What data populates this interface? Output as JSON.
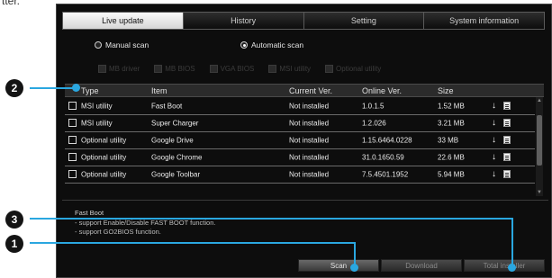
{
  "fragment": "tter.",
  "tabs": [
    "Live update",
    "History",
    "Setting",
    "System information"
  ],
  "scan_mode": {
    "manual_label": "Manual scan",
    "automatic_label": "Automatic scan"
  },
  "filters": [
    "MB driver",
    "MB BIOS",
    "VGA BIOS",
    "MSI utility",
    "Optional utility"
  ],
  "columns": {
    "type": "Type",
    "item": "Item",
    "current": "Current Ver.",
    "online": "Online Ver.",
    "size": "Size"
  },
  "rows": [
    {
      "type": "MSI utility",
      "item": "Fast Boot",
      "current": "Not installed",
      "online": "1.0.1.5",
      "size": "1.52 MB"
    },
    {
      "type": "MSI utility",
      "item": "Super Charger",
      "current": "Not installed",
      "online": "1.2.026",
      "size": "3.21 MB"
    },
    {
      "type": "Optional utility",
      "item": "Google Drive",
      "current": "Not installed",
      "online": "1.15.6464.0228",
      "size": "33 MB"
    },
    {
      "type": "Optional utility",
      "item": "Google Chrome",
      "current": "Not installed",
      "online": "31.0.1650.59",
      "size": "22.6 MB"
    },
    {
      "type": "Optional utility",
      "item": "Google Toolbar",
      "current": "Not installed",
      "online": "7.5.4501.1952",
      "size": "5.94 MB"
    }
  ],
  "description": {
    "title": "Fast Boot",
    "line1": "- support Enable/Disable FAST BOOT function.",
    "line2": "- support GO2BIOS function."
  },
  "buttons": {
    "scan": "Scan",
    "download": "Download",
    "total_installer": "Total installer"
  },
  "callouts": [
    "1",
    "2",
    "3"
  ],
  "colors": {
    "callout_line": "#2aa7e0",
    "active_tab": "#e8e8e8",
    "window_bg": "#0d0d0d"
  }
}
